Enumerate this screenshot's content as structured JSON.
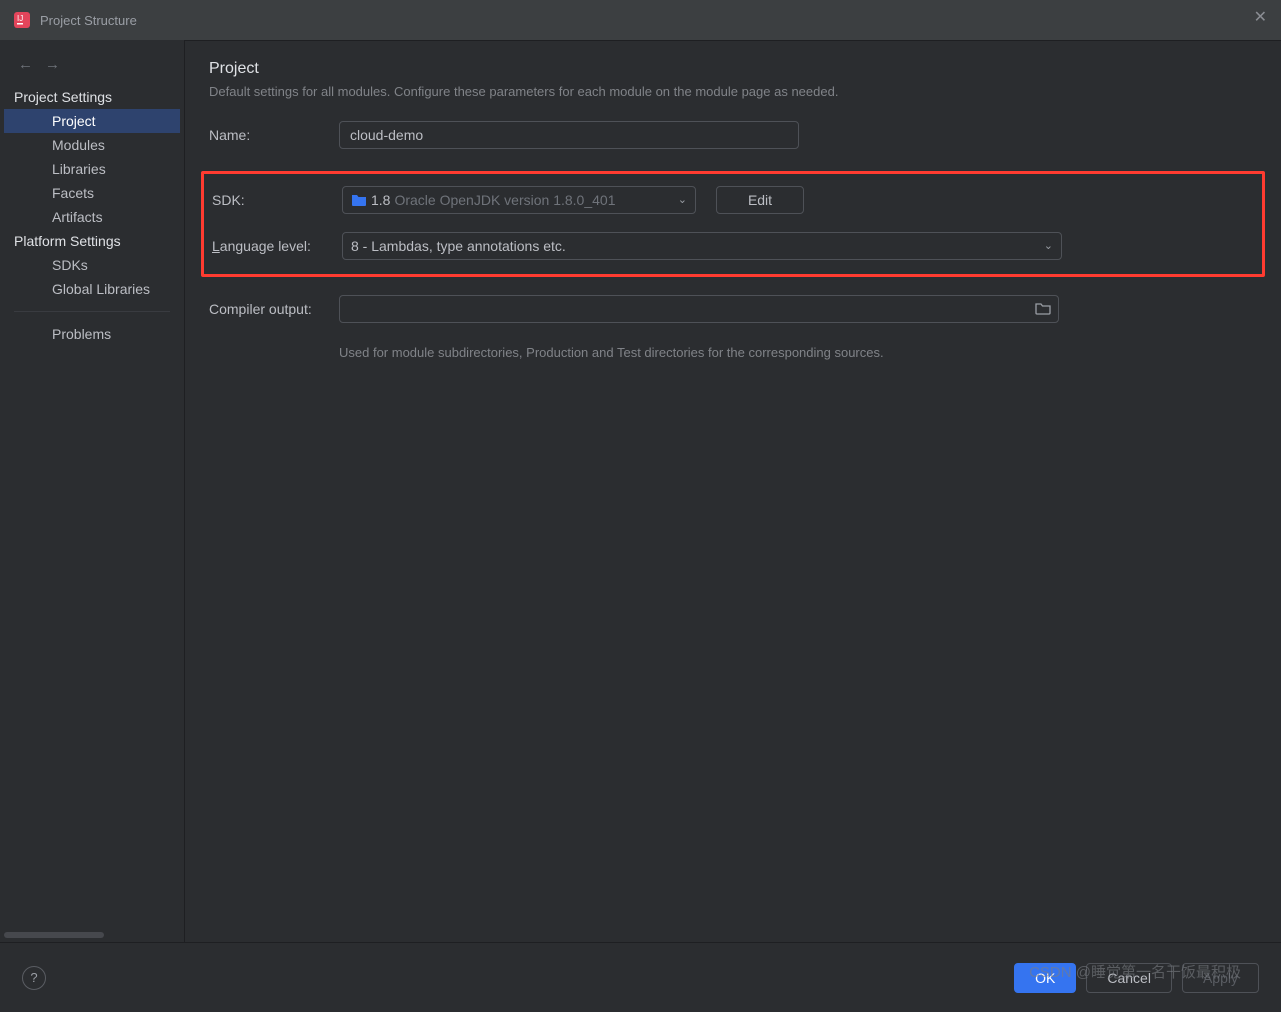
{
  "window": {
    "title": "Project Structure"
  },
  "sidebar": {
    "section1_title": "Project Settings",
    "section1_items": [
      "Project",
      "Modules",
      "Libraries",
      "Facets",
      "Artifacts"
    ],
    "section2_title": "Platform Settings",
    "section2_items": [
      "SDKs",
      "Global Libraries"
    ],
    "problems_label": "Problems"
  },
  "page": {
    "title": "Project",
    "description": "Default settings for all modules. Configure these parameters for each module on the module page as needed."
  },
  "form": {
    "name_label": "Name:",
    "name_value": "cloud-demo",
    "sdk_label": "SDK:",
    "sdk_version": "1.8",
    "sdk_detail": "Oracle OpenJDK version 1.8.0_401",
    "edit_label": "Edit",
    "lang_label_prefix": "L",
    "lang_label_rest": "anguage level:",
    "lang_value": "8 - Lambdas, type annotations etc.",
    "compiler_label": "Compiler output:",
    "compiler_value": "",
    "compiler_help": "Used for module subdirectories, Production and Test directories for the corresponding sources."
  },
  "buttons": {
    "ok": "OK",
    "cancel": "Cancel",
    "apply": "Apply"
  },
  "watermark": "CSDN @睡觉第一名干饭最积极"
}
